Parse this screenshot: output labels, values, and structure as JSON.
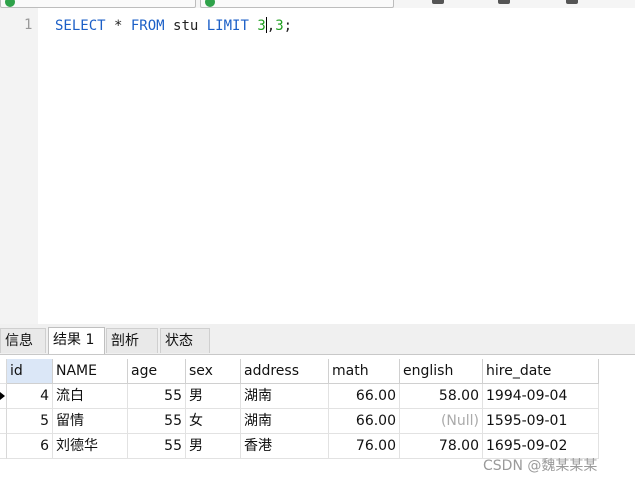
{
  "editor": {
    "line_number": "1",
    "kw_select": "SELECT",
    "star": " * ",
    "kw_from": "FROM",
    "table": " stu ",
    "kw_limit": "LIMIT",
    "space": " ",
    "offset": "3",
    "comma": ",",
    "count": "3",
    "semicolon": ";"
  },
  "tabs": [
    {
      "label": "信息"
    },
    {
      "label": "结果 1",
      "active": true
    },
    {
      "label": "剖析"
    },
    {
      "label": "状态"
    }
  ],
  "grid": {
    "columns": [
      "id",
      "NAME",
      "age",
      "sex",
      "address",
      "math",
      "english",
      "hire_date"
    ],
    "rows": [
      [
        "4",
        "流白",
        "55",
        "男",
        "湖南",
        "66.00",
        "58.00",
        "1994-09-04"
      ],
      [
        "5",
        "留情",
        "55",
        "女",
        "湖南",
        "66.00",
        "(Null)",
        "1595-09-01"
      ],
      [
        "6",
        "刘德华",
        "55",
        "男",
        "香港",
        "76.00",
        "78.00",
        "1695-09-02"
      ]
    ]
  },
  "watermark": "CSDN @魏某某某"
}
